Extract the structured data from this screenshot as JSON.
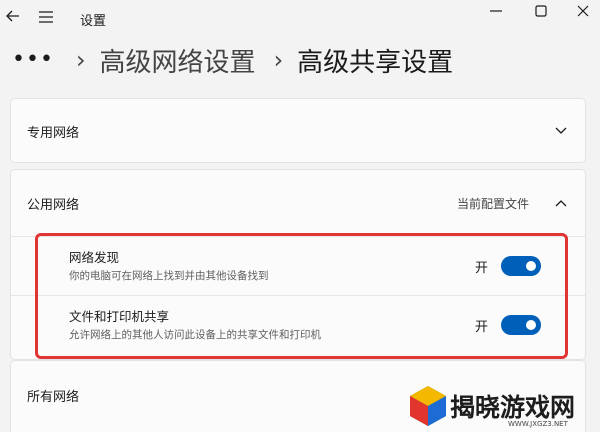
{
  "window": {
    "title": "设置"
  },
  "breadcrumb": {
    "more": "•••",
    "items": [
      "高级网络设置",
      "高级共享设置"
    ]
  },
  "sections": {
    "private": {
      "label": "专用网络"
    },
    "public": {
      "label": "公用网络",
      "status": "当前配置文件",
      "settings": [
        {
          "title": "网络发现",
          "description": "你的电脑可在网络上找到并由其他设备找到",
          "toggle_label": "开",
          "on": true
        },
        {
          "title": "文件和打印机共享",
          "description": "允许网络上的其他人访问此设备上的共享文件和打印机",
          "toggle_label": "开",
          "on": true
        }
      ]
    },
    "all": {
      "label": "所有网络"
    }
  },
  "colors": {
    "accent": "#005fb8",
    "highlight": "#e03535"
  },
  "logo": {
    "text": "揭晓游戏网",
    "url": "WWW.JXGZ3.NET"
  }
}
